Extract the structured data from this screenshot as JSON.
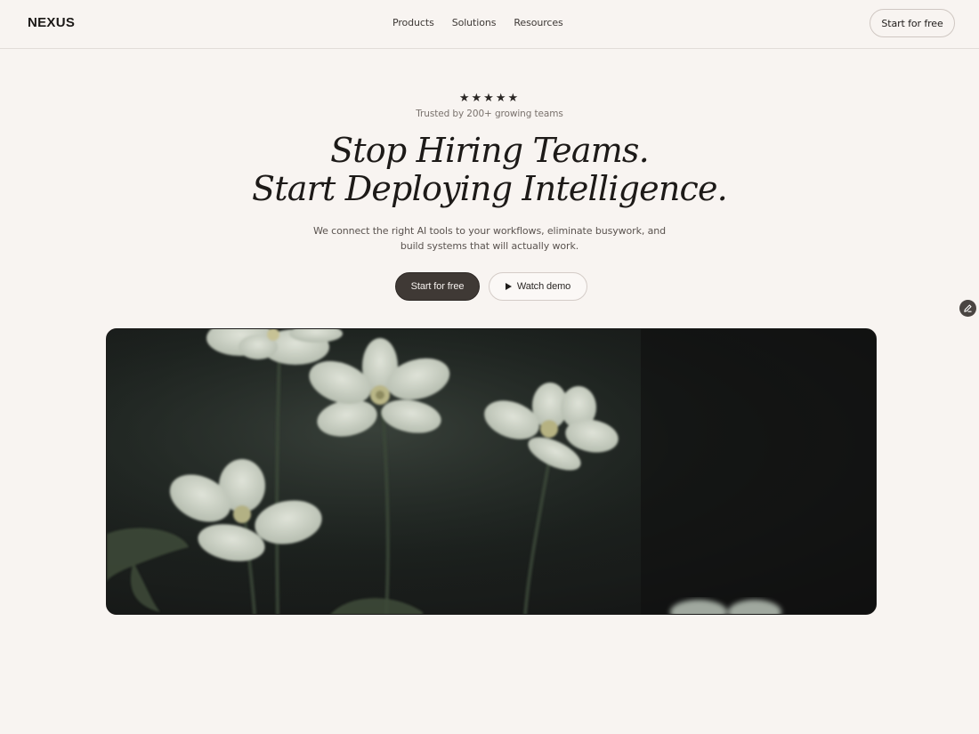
{
  "header": {
    "logo": "NEXUS",
    "nav": [
      "Products",
      "Solutions",
      "Resources"
    ],
    "cta_label": "Start for free"
  },
  "hero": {
    "stars": "★★★★★",
    "rating_count": 5,
    "trusted_text": "Trusted by 200+ growing teams",
    "headline_line1": "Stop Hiring Teams.",
    "headline_line2": "Start Deploying Intelligence.",
    "subtext": "We connect the right AI tools to your workflows, eliminate busywork, and build systems that will actually work.",
    "primary_button": "Start for free",
    "secondary_button": "Watch demo"
  },
  "icons": {
    "play": "play-icon",
    "edit": "pencil-icon"
  },
  "colors": {
    "background": "#f8f4f1",
    "primary_button": "#3f3935",
    "text_dark": "#1d1a18",
    "media_bg": "#1d221f",
    "flower_petal": "#c9cfc2"
  }
}
